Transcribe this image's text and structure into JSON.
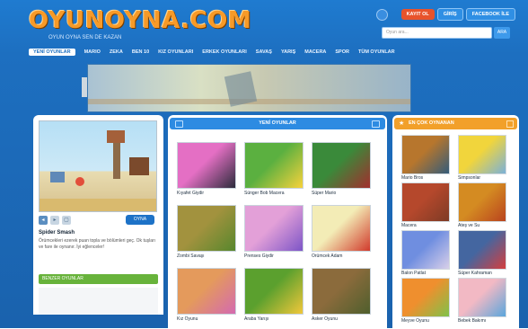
{
  "header": {
    "logo_text": "OYUNOYNA.COM",
    "logo_tagline": "OYUN OYNA SEN DE KAZAN",
    "buttons": [
      "KAYIT OL",
      "GİRİŞ",
      "FACEBOOK İLE"
    ],
    "search_placeholder": "Oyun ara...",
    "search_button": "ARA"
  },
  "nav": {
    "items": [
      "YENİ OYUNLAR",
      "MARIO",
      "ZEKA",
      "BEN 10",
      "KIZ OYUNLARI",
      "ERKEK OYUNLARI",
      "SAVAŞ",
      "YARIŞ",
      "MACERA",
      "SPOR",
      "TÜM OYUNLAR"
    ]
  },
  "left": {
    "game_title": "Spider Smash",
    "game_desc": "Örümcekleri ezerek puan topla ve bölümleri geç. Ok tuşları ve fare ile oynanır. İyi eğlenceler!",
    "play_label": "OYNA",
    "green_bar": "BENZER OYUNLAR"
  },
  "center": {
    "header": "YENİ OYUNLAR",
    "tiles": [
      {
        "caption": "Kıyafet Giydir",
        "c1": "#e46fc4",
        "c2": "#2c2c3c"
      },
      {
        "caption": "Sünger Bob Macera",
        "c1": "#5bb040",
        "c2": "#f7d23c"
      },
      {
        "caption": "Süper Mario",
        "c1": "#3a8a3a",
        "c2": "#a22e2e"
      },
      {
        "caption": "Zombi Savaşı",
        "c1": "#a2923e",
        "c2": "#57872d"
      },
      {
        "caption": "Prenses Giydir",
        "c1": "#e3a0d8",
        "c2": "#7d55c7"
      },
      {
        "caption": "Örümcek Adam",
        "c1": "#f3ecb6",
        "c2": "#d13a2c"
      },
      {
        "caption": "Kız Oyunu",
        "c1": "#e49a5c",
        "c2": "#d46ab0"
      },
      {
        "caption": "Araba Yarışı",
        "c1": "#5ba02e",
        "c2": "#f1c73a"
      },
      {
        "caption": "Asker Oyunu",
        "c1": "#8b6b3c",
        "c2": "#4f5f2d"
      }
    ]
  },
  "right": {
    "header": "EN ÇOK OYNANAN",
    "tiles": [
      {
        "caption": "Mario Bros",
        "c1": "#b7762d",
        "c2": "#345c7a"
      },
      {
        "caption": "Simpsonlar",
        "c1": "#f1d53c",
        "c2": "#7bb1d8"
      },
      {
        "caption": "Macera",
        "c1": "#b5482c",
        "c2": "#7d3b25"
      },
      {
        "caption": "Ateş ve Su",
        "c1": "#d48b22",
        "c2": "#b9431e"
      },
      {
        "caption": "Balon Patlat",
        "c1": "#6f8ee0",
        "c2": "#d8cfe9"
      },
      {
        "caption": "Süper Kahraman",
        "c1": "#4466a0",
        "c2": "#d43e3e"
      },
      {
        "caption": "Meyve Oyunu",
        "c1": "#ef8f2e",
        "c2": "#7fc24a"
      },
      {
        "caption": "Bebek Bakımı",
        "c1": "#f2b9c4",
        "c2": "#5aa6dc"
      }
    ]
  }
}
